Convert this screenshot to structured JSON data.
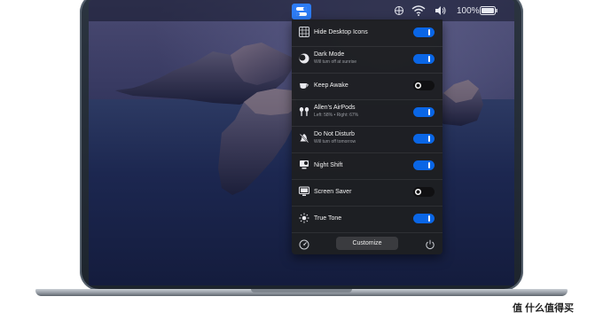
{
  "menubar": {
    "battery_text": "100%",
    "icons": [
      "app-toggle-icon",
      "display-arrows-icon",
      "wifi-icon",
      "volume-icon",
      "battery-icon"
    ]
  },
  "panel": {
    "items": [
      {
        "title": "Hide Desktop Icons",
        "subtitle": "",
        "icon": "desktop-grid-icon",
        "enabled": true
      },
      {
        "title": "Dark Mode",
        "subtitle": "Will turn off at sunrise",
        "icon": "moon-icon",
        "enabled": true
      },
      {
        "title": "Keep Awake",
        "subtitle": "",
        "icon": "coffee-cup-icon",
        "enabled": false
      },
      {
        "title": "Allen's AirPods",
        "subtitle": "Left: 58% • Right: 67%",
        "icon": "airpods-icon",
        "enabled": true
      },
      {
        "title": "Do Not Disturb",
        "subtitle": "Will turn off tomorrow",
        "icon": "do-not-disturb-icon",
        "enabled": true
      },
      {
        "title": "Night Shift",
        "subtitle": "",
        "icon": "night-shift-icon",
        "enabled": true
      },
      {
        "title": "Screen Saver",
        "subtitle": "",
        "icon": "screen-saver-icon",
        "enabled": false
      },
      {
        "title": "True Tone",
        "subtitle": "",
        "icon": "true-tone-icon",
        "enabled": true
      }
    ],
    "footer": {
      "customize_label": "Customize",
      "left_icon": "speedometer-icon",
      "right_icon": "power-icon"
    }
  },
  "watermark": {
    "text": "值 什么值得买"
  },
  "colors": {
    "accent": "#0a66e6",
    "panel_bg": "#1e1f22",
    "menu_icon_bg": "#2d7cf6"
  }
}
